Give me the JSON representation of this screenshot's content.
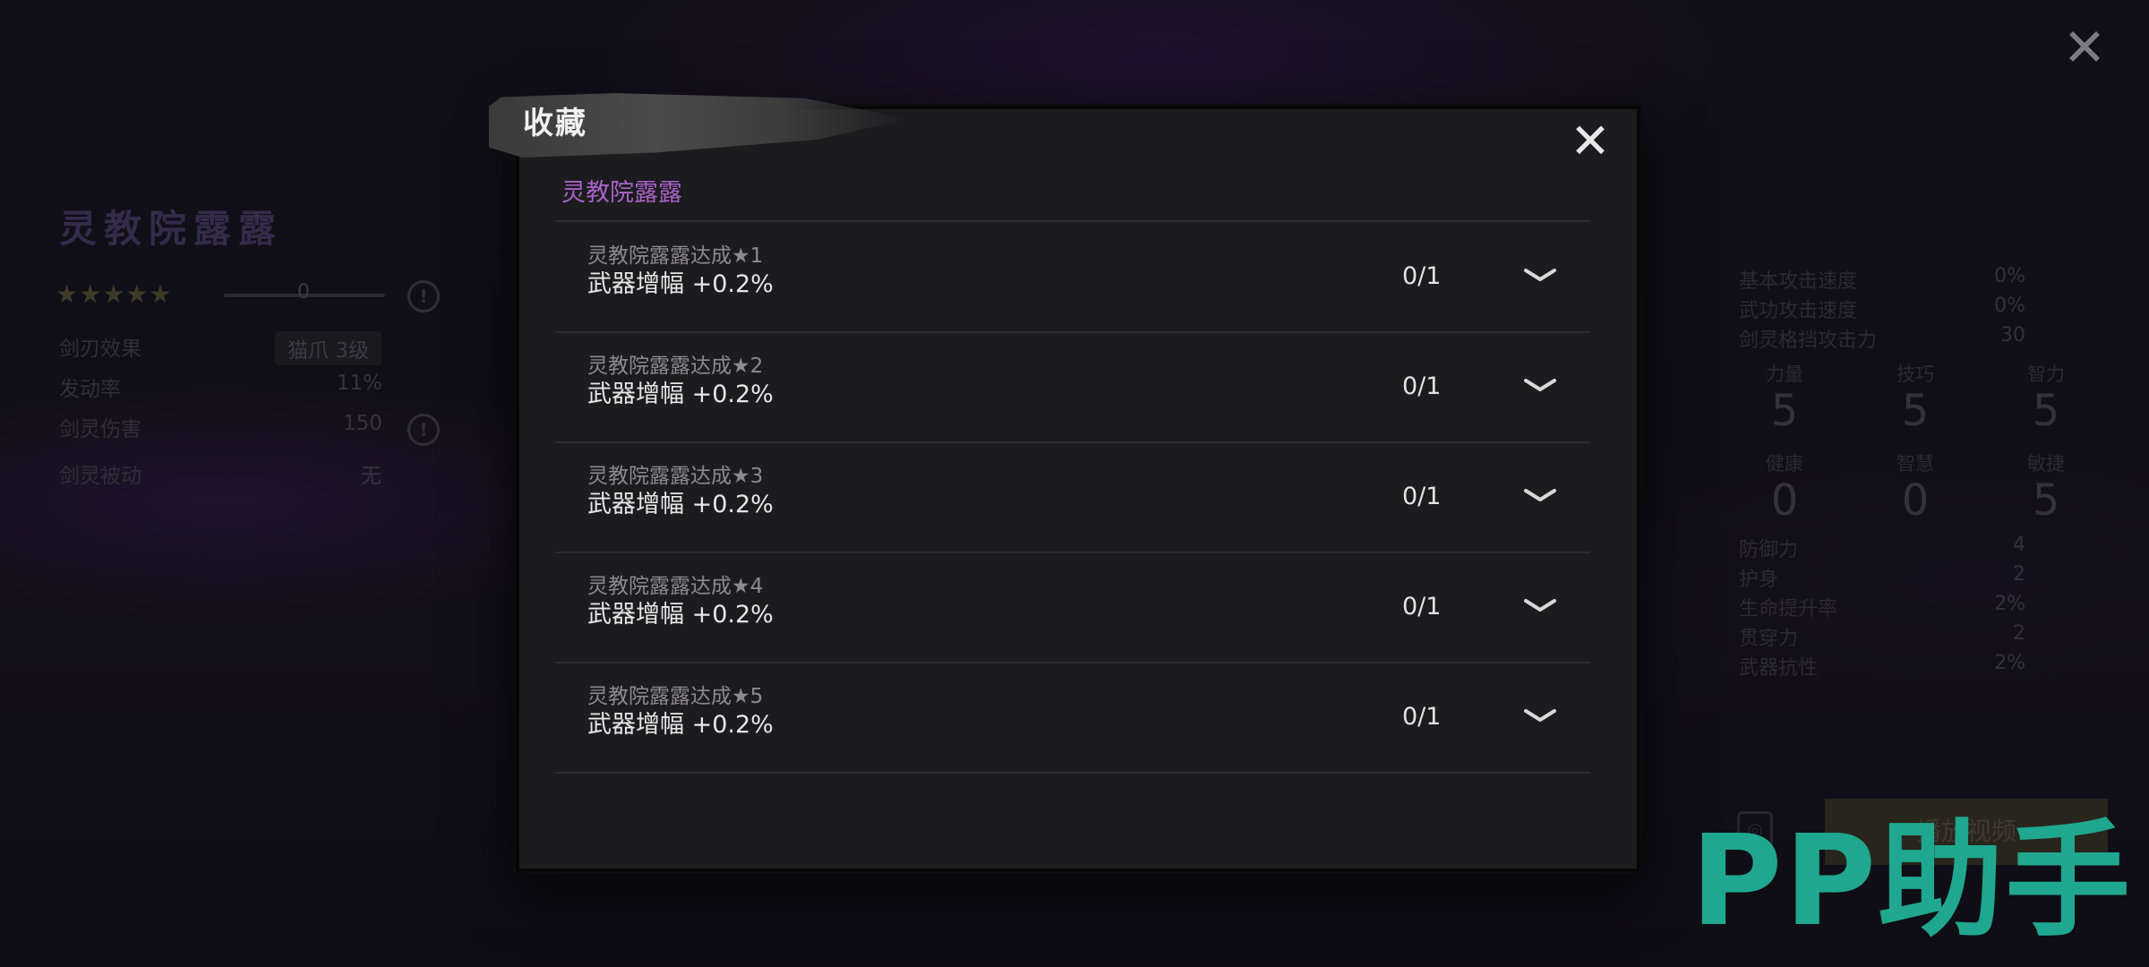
{
  "background": {
    "character": {
      "name": "灵教院露露",
      "stars": "★★★★★",
      "level_value": "0",
      "rows": [
        {
          "key": "剑刃效果",
          "value": "猫爪 3级"
        },
        {
          "key": "发动率",
          "value": "11%"
        },
        {
          "key": "剑灵伤害",
          "value": "150"
        },
        {
          "key": "剑灵被动",
          "value": "无"
        }
      ]
    },
    "stats": {
      "top": [
        {
          "key": "基本攻击速度",
          "value": "0%"
        },
        {
          "key": "武功攻击速度",
          "value": "0%"
        },
        {
          "key": "剑灵格挡攻击力",
          "value": "30"
        }
      ],
      "attributes": [
        {
          "label": "力量",
          "value": "5"
        },
        {
          "label": "技巧",
          "value": "5"
        },
        {
          "label": "智力",
          "value": "5"
        },
        {
          "label": "健康",
          "value": "0"
        },
        {
          "label": "智慧",
          "value": "0"
        },
        {
          "label": "敏捷",
          "value": "5"
        }
      ],
      "bottom": [
        {
          "key": "防御力",
          "value": "4"
        },
        {
          "key": "护身",
          "value": "2"
        },
        {
          "key": "生命提升率",
          "value": "2%"
        },
        {
          "key": "贯穿力",
          "value": "2"
        },
        {
          "key": "武器抗性",
          "value": "2%"
        }
      ]
    },
    "play_button_label": "播放视频",
    "watermark": "PP助手"
  },
  "modal": {
    "title": "收藏",
    "section_title": "灵教院露露",
    "items": [
      {
        "name": "灵教院露露达成★1",
        "effect": "武器增幅 +0.2%",
        "progress": "0/1"
      },
      {
        "name": "灵教院露露达成★2",
        "effect": "武器增幅 +0.2%",
        "progress": "0/1"
      },
      {
        "name": "灵教院露露达成★3",
        "effect": "武器增幅 +0.2%",
        "progress": "0/1"
      },
      {
        "name": "灵教院露露达成★4",
        "effect": "武器增幅 +0.2%",
        "progress": "0/1"
      },
      {
        "name": "灵教院露露达成★5",
        "effect": "武器增幅 +0.2%",
        "progress": "0/1"
      }
    ]
  },
  "icons": {
    "close": "close-icon",
    "chevron": "chevron-down-icon",
    "info": "info-icon"
  },
  "colors": {
    "accent_purple": "#a862c8",
    "watermark_green": "#1fa88f"
  }
}
